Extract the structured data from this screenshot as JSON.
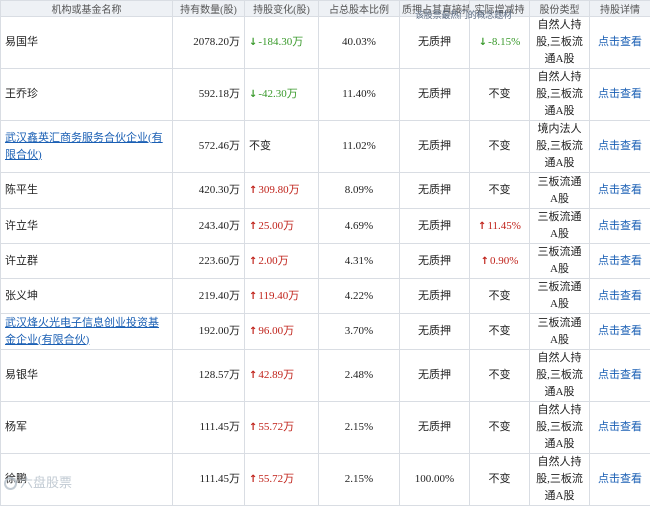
{
  "headers": [
    "机构或基金名称",
    "持有数量(股)",
    "持股变化(股)",
    "占总股本比例",
    "质押占其直接持股比",
    "实际增减持",
    "股份类型",
    "持股详情"
  ],
  "overlay_text": "该股票最热门的概念题材",
  "watermark": "六盘股票",
  "rows": [
    {
      "name": "易国华",
      "name_link": false,
      "qty": "2078.20万",
      "change": "-184.30万",
      "dir": "down",
      "ratio": "40.03%",
      "pledge": "无质押",
      "actual": "-8.15%",
      "actual_dir": "down",
      "type": "自然人持股,三板流通A股",
      "detail": "点击查看"
    },
    {
      "name": "王乔珍",
      "name_link": false,
      "qty": "592.18万",
      "change": "-42.30万",
      "dir": "down",
      "ratio": "11.40%",
      "pledge": "无质押",
      "actual": "不变",
      "actual_dir": "",
      "type": "自然人持股,三板流通A股",
      "detail": "点击查看"
    },
    {
      "name": "武汉鑫英汇商务服务合伙企业(有限合伙)",
      "name_link": true,
      "qty": "572.46万",
      "change": "不变",
      "dir": "",
      "ratio": "11.02%",
      "pledge": "无质押",
      "actual": "不变",
      "actual_dir": "",
      "type": "境内法人股,三板流通A股",
      "detail": "点击查看"
    },
    {
      "name": "陈平生",
      "name_link": false,
      "qty": "420.30万",
      "change": "309.80万",
      "dir": "up",
      "ratio": "8.09%",
      "pledge": "无质押",
      "actual": "不变",
      "actual_dir": "",
      "type": "三板流通A股",
      "detail": "点击查看"
    },
    {
      "name": "许立华",
      "name_link": false,
      "qty": "243.40万",
      "change": "25.00万",
      "dir": "up",
      "ratio": "4.69%",
      "pledge": "无质押",
      "actual": "11.45%",
      "actual_dir": "up",
      "type": "三板流通A股",
      "detail": "点击查看"
    },
    {
      "name": "许立群",
      "name_link": false,
      "qty": "223.60万",
      "change": "2.00万",
      "dir": "up",
      "ratio": "4.31%",
      "pledge": "无质押",
      "actual": "0.90%",
      "actual_dir": "up",
      "type": "三板流通A股",
      "detail": "点击查看"
    },
    {
      "name": "张义坤",
      "name_link": false,
      "qty": "219.40万",
      "change": "119.40万",
      "dir": "up",
      "ratio": "4.22%",
      "pledge": "无质押",
      "actual": "不变",
      "actual_dir": "",
      "type": "三板流通A股",
      "detail": "点击查看"
    },
    {
      "name": "武汉烽火光电子信息创业投资基金企业(有限合伙)",
      "name_link": true,
      "qty": "192.00万",
      "change": "96.00万",
      "dir": "up",
      "ratio": "3.70%",
      "pledge": "无质押",
      "actual": "不变",
      "actual_dir": "",
      "type": "三板流通A股",
      "detail": "点击查看"
    },
    {
      "name": "易银华",
      "name_link": false,
      "qty": "128.57万",
      "change": "42.89万",
      "dir": "up",
      "ratio": "2.48%",
      "pledge": "无质押",
      "actual": "不变",
      "actual_dir": "",
      "type": "自然人持股,三板流通A股",
      "detail": "点击查看"
    },
    {
      "name": "杨军",
      "name_link": false,
      "qty": "111.45万",
      "change": "55.72万",
      "dir": "up",
      "ratio": "2.15%",
      "pledge": "无质押",
      "actual": "不变",
      "actual_dir": "",
      "type": "自然人持股,三板流通A股",
      "detail": "点击查看"
    },
    {
      "name": "徐鹏",
      "name_link": false,
      "qty": "111.45万",
      "change": "55.72万",
      "dir": "up",
      "ratio": "2.15%",
      "pledge": "100.00%",
      "actual": "不变",
      "actual_dir": "",
      "type": "自然人持股,三板流通A股",
      "detail": "点击查看"
    }
  ],
  "colors": {
    "up": "#c0231b",
    "down": "#3a9a2c",
    "link": "#1a5fb4",
    "header_bg": "#eef1f5"
  },
  "icons": {
    "up": "arrow-up-icon",
    "down": "arrow-down-icon"
  }
}
